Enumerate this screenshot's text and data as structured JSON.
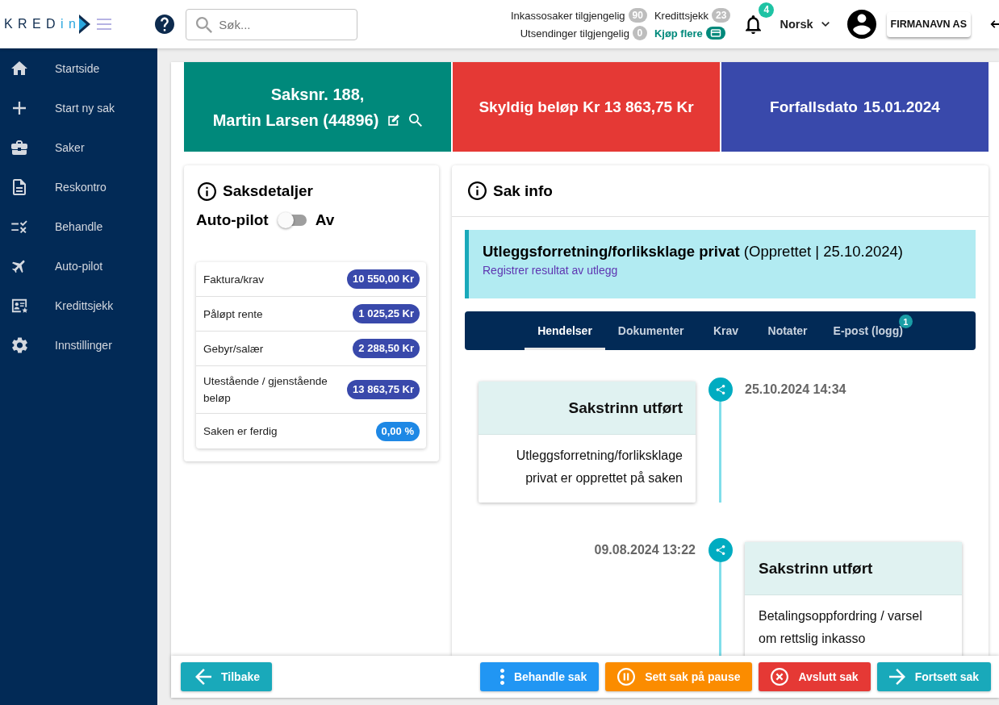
{
  "top_bar": {
    "logo": {
      "part_1": "KRED",
      "part_2": "in"
    },
    "search": {
      "placeholder": "Søk..."
    },
    "stats": [
      {
        "kind": "count",
        "label": "Inkassosaker tilgjengelig",
        "value": "90"
      },
      {
        "kind": "count",
        "label": "Kredittsjekk",
        "value": "23"
      },
      {
        "kind": "count",
        "label": "Utsendinger tilgjengelig",
        "value": "0"
      },
      {
        "kind": "link",
        "label": "Kjøp flere"
      }
    ],
    "notifications": {
      "count": "4"
    },
    "language": "Norsk",
    "company": "FIRMANAVN AS"
  },
  "sidebar": {
    "items": [
      {
        "label": "Startside",
        "selected": false
      },
      {
        "label": "Start ny sak",
        "selected": false
      },
      {
        "label": "Saker",
        "selected": false
      },
      {
        "label": "Reskontro",
        "selected": false
      },
      {
        "label": "Behandle",
        "selected": false
      },
      {
        "label": "Auto-pilot",
        "selected": false
      },
      {
        "label": "Kredittsjekk",
        "selected": false
      },
      {
        "label": "Innstillinger",
        "selected": false
      }
    ]
  },
  "case_header": [
    {
      "kind": "case",
      "lines": [
        "Saksnr. 188,",
        "Martin Larsen (44896)"
      ],
      "color": "#00897b"
    },
    {
      "kind": "amount",
      "text": "Skyldig beløp Kr 13 863,75 Kr",
      "color": "#e53935"
    },
    {
      "kind": "due",
      "label": "Forfallsdato",
      "value": "15.01.2024",
      "color": "#3949ab"
    }
  ],
  "case_details": {
    "title": "Saksdetaljer",
    "autopilot": {
      "label": "Auto-pilot",
      "on": false,
      "state": "Av"
    },
    "rows": [
      {
        "label": "Faktura/krav",
        "value": "10 550,00 Kr",
        "color": "#3949ab"
      },
      {
        "label": "Påløpt rente",
        "value": "1 025,25 Kr",
        "color": "#3949ab"
      },
      {
        "label": "Gebyr/salær",
        "value": "2 288,50 Kr",
        "color": "#3949ab"
      },
      {
        "label": "Utestående / gjenstående beløp",
        "value": "13 863,75 Kr",
        "color": "#3949ab"
      },
      {
        "label": "Saken er ferdig",
        "value": "0,00 %",
        "color": "#1e88e5"
      }
    ]
  },
  "case_info": {
    "title": "Sak info",
    "status": {
      "text": "**Utleggsforretning/forliksklage privat** (Opprettet | 25.10.2024)",
      "link": "Registrer resultat av utlegg"
    },
    "tabs": [
      {
        "label": "Hendelser",
        "selected": true
      },
      {
        "label": "Dokumenter",
        "selected": false
      },
      {
        "label": "Krav",
        "selected": false
      },
      {
        "label": "Notater",
        "selected": false
      },
      {
        "label": "E-post (logg)",
        "selected": false,
        "badge": "1"
      }
    ],
    "events": [
      {
        "time": "25.10.2024 14:34",
        "title": "Sakstrinn utført",
        "text": "Utleggsforretning/forliksklage privat er opprettet på saken"
      },
      {
        "time": "09.08.2024 13:22",
        "title": "Sakstrinn utført",
        "text": "Betalingsoppfordring / varsel om rettslig inkasso"
      }
    ]
  },
  "action_bar": {
    "back": {
      "label": "Tilbake",
      "color": "#19a9ba"
    },
    "actions": [
      {
        "label": "Behandle sak",
        "color": "#2196f3"
      },
      {
        "label": "Sett sak på pause",
        "color": "#fb8c00"
      },
      {
        "label": "Avslutt sak",
        "color": "#e53935"
      },
      {
        "label": "Fortsett sak",
        "color": "#19a9ba"
      }
    ]
  }
}
